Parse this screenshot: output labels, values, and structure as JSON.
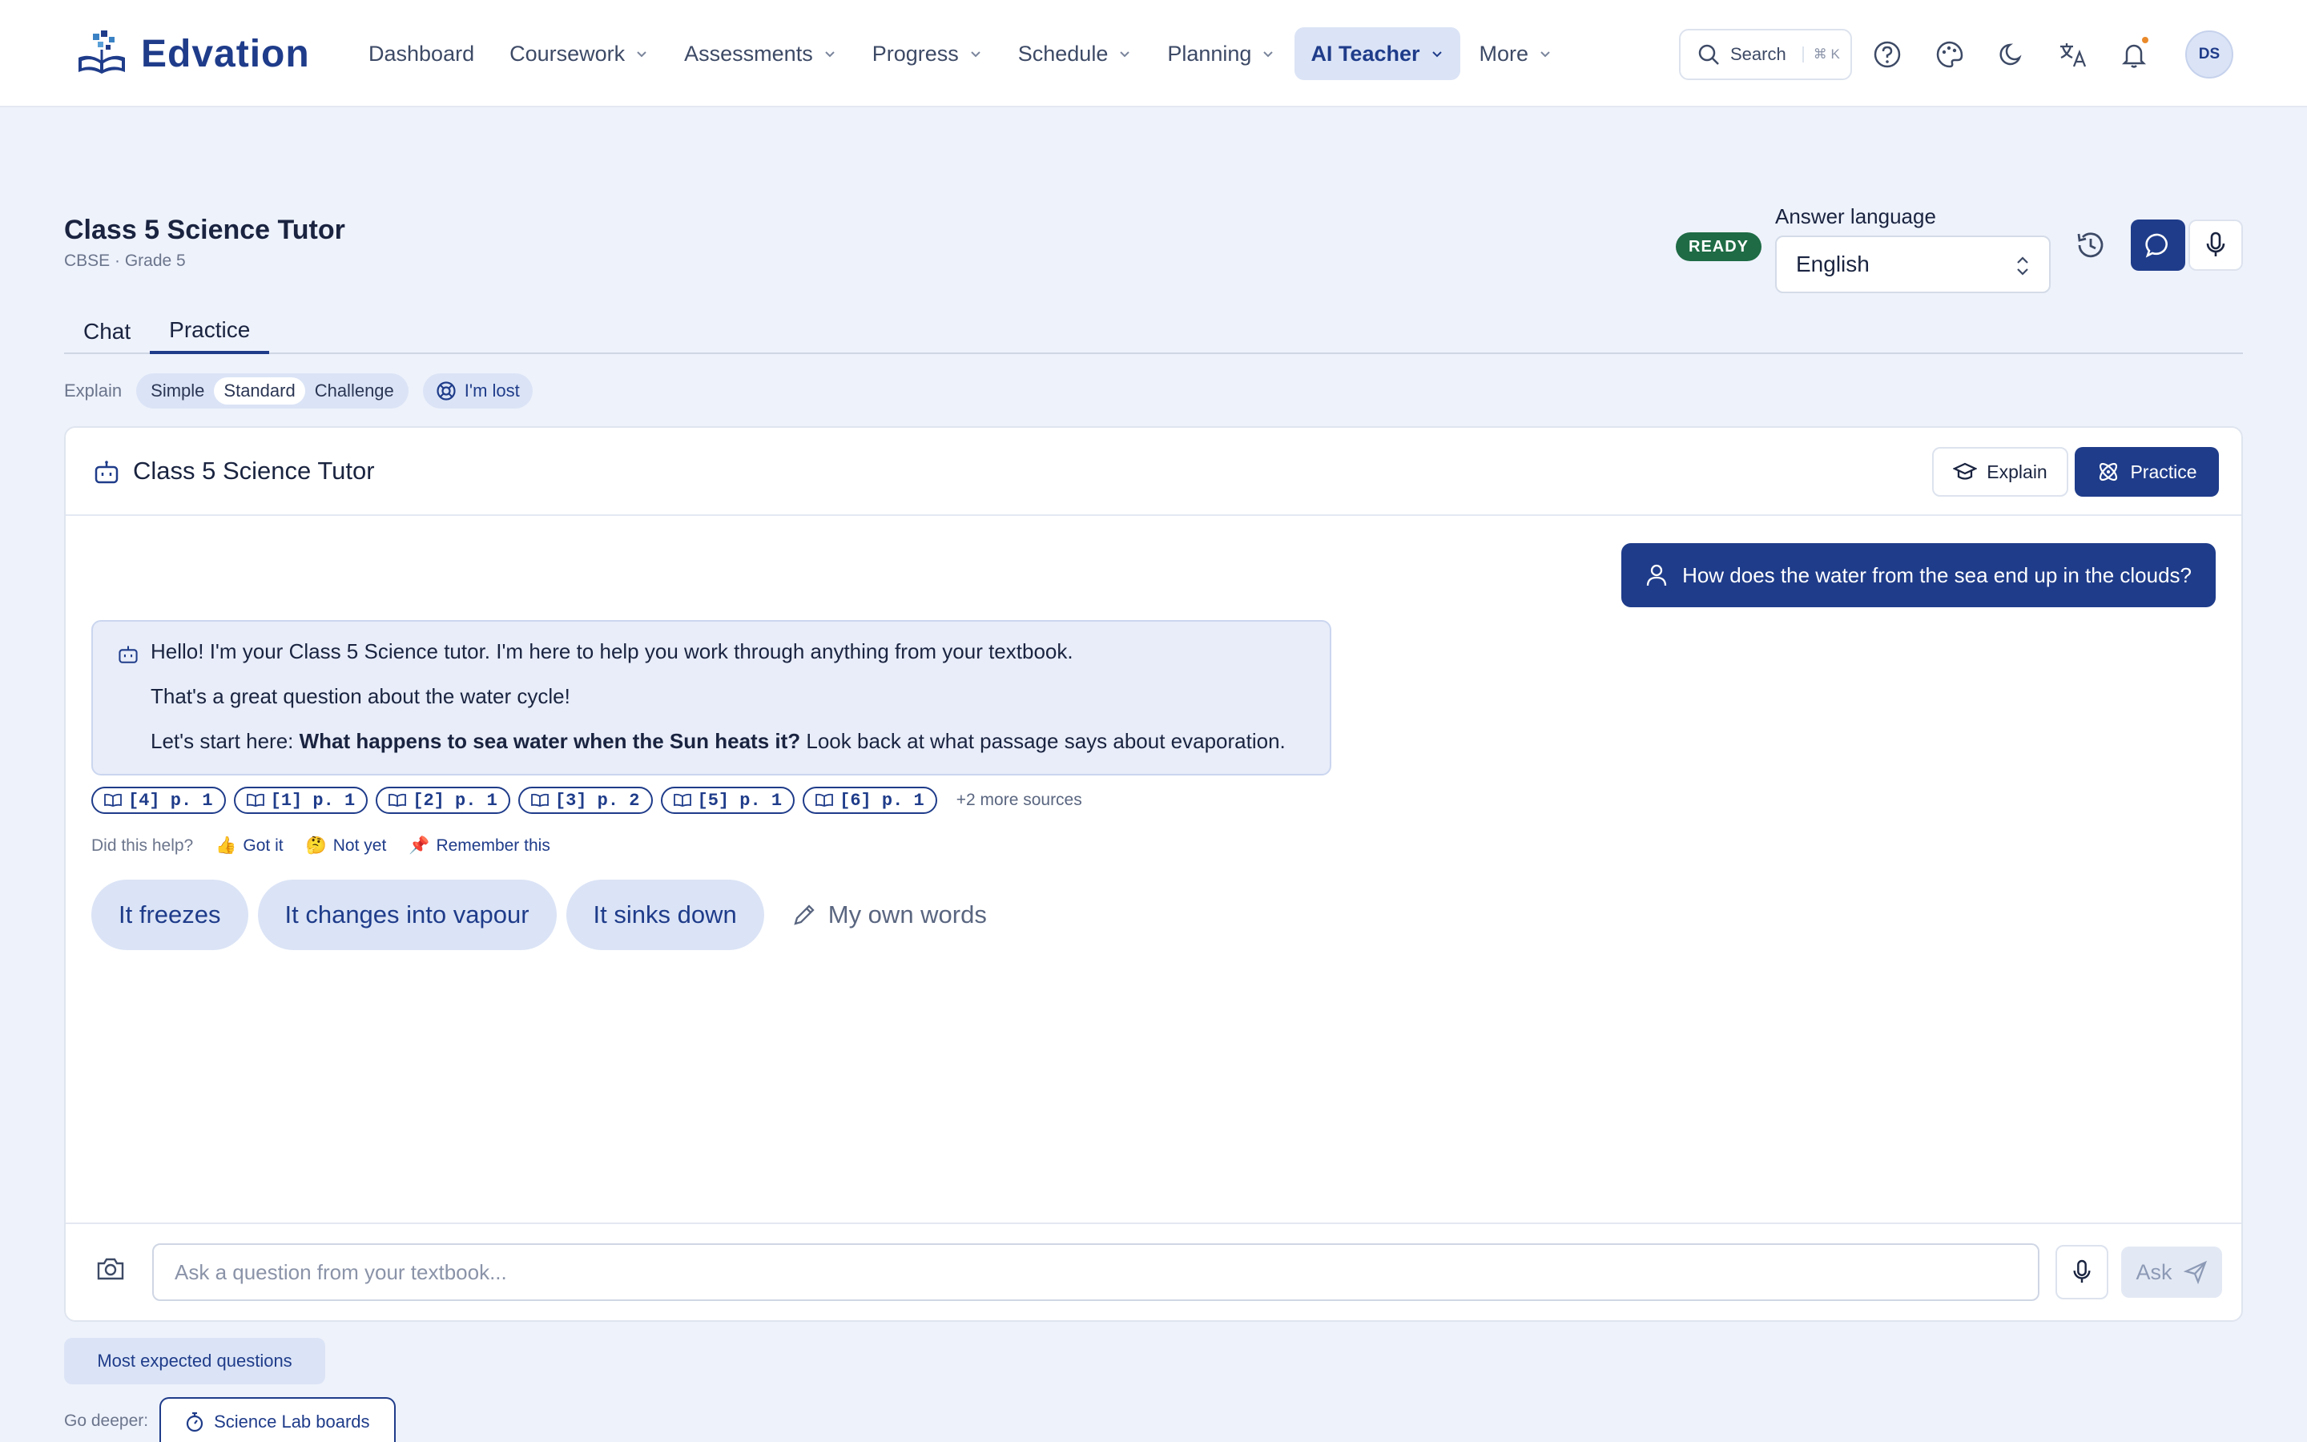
{
  "brand": {
    "name": "Edvation",
    "primary": "#1f3c8a",
    "background": "#eef2fb"
  },
  "nav": {
    "items": [
      {
        "label": "Dashboard",
        "has_menu": false,
        "active": false
      },
      {
        "label": "Coursework",
        "has_menu": true,
        "active": false
      },
      {
        "label": "Assessments",
        "has_menu": true,
        "active": false
      },
      {
        "label": "Progress",
        "has_menu": true,
        "active": false
      },
      {
        "label": "Schedule",
        "has_menu": true,
        "active": false
      },
      {
        "label": "Planning",
        "has_menu": true,
        "active": false
      },
      {
        "label": "AI Teacher",
        "has_menu": true,
        "active": true
      },
      {
        "label": "More",
        "has_menu": true,
        "active": false
      }
    ],
    "search_label": "Search",
    "search_shortcut": "⌘ K",
    "icons": [
      "help-icon",
      "palette-icon",
      "moon-icon",
      "translate-icon",
      "bell-icon"
    ],
    "avatar_initials": "DS"
  },
  "page": {
    "title": "Class 5 Science Tutor",
    "subtitle": "CBSE · Grade 5",
    "status_badge": "READY",
    "status_color": "#1e6b45",
    "language_label": "Answer language",
    "language_value": "English"
  },
  "tabs": [
    {
      "label": "Chat",
      "active": false
    },
    {
      "label": "Practice",
      "active": true
    }
  ],
  "explain_level": {
    "label": "Explain",
    "options": [
      "Simple",
      "Standard",
      "Challenge"
    ],
    "selected": "Standard",
    "lost_label": "I'm lost"
  },
  "chat": {
    "header_title": "Class 5 Science Tutor",
    "explain_button": "Explain",
    "practice_button": "Practice",
    "user_message": "How does the water from the sea end up in the clouds?",
    "bot_lines": {
      "greeting": "Hello! I'm your Class 5 Science tutor. I'm here to help you work through anything from your textbook.",
      "praise": "That's a great question about the water cycle!",
      "prompt_start": "Let's start here: ",
      "prompt_question": "What happens to sea water when the Sun heats it?",
      "prompt_end": " Look back at what passage says about evaporation."
    },
    "sources": [
      "[4] p. 1",
      "[1] p. 1",
      "[2] p. 1",
      "[3] p. 2",
      "[5] p. 1",
      "[6] p. 1"
    ],
    "more_sources": "+2 more sources",
    "feedback": {
      "label": "Did this help?",
      "got_it": "Got it",
      "not_yet": "Not yet",
      "remember": "Remember this"
    },
    "answer_options": [
      "It freezes",
      "It changes into vapour",
      "It sinks down"
    ],
    "own_words": "My own words",
    "input_placeholder": "Ask a question from your textbook...",
    "ask_label": "Ask"
  },
  "footer": {
    "expected_questions": "Most expected questions",
    "go_deeper_label": "Go deeper:",
    "go_deeper_chip": "Science Lab boards"
  }
}
